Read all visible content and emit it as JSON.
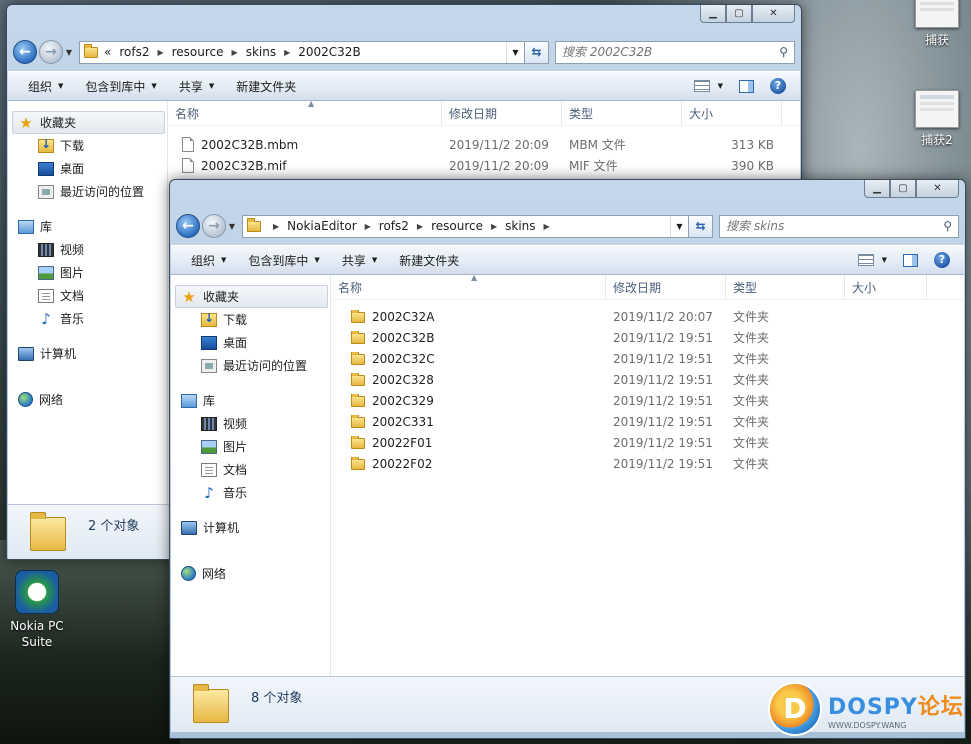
{
  "desktop": {
    "icons": [
      {
        "label": "捕获"
      },
      {
        "label": "捕获2"
      },
      {
        "label": "Nokia PC\nSuite"
      }
    ],
    "watermark": {
      "brand": "DOSPY",
      "brand_cn": "论坛",
      "url": "WWW.DOSPY.WANG"
    }
  },
  "back_window": {
    "breadcrumbs": [
      "«",
      "rofs2",
      "resource",
      "skins",
      "2002C32B"
    ],
    "search_placeholder": "搜索 2002C32B",
    "toolbar": {
      "organize": "组织",
      "include": "包含到库中",
      "share": "共享",
      "new_folder": "新建文件夹"
    },
    "nav": {
      "favorites": "收藏夹",
      "downloads": "下载",
      "desktop": "桌面",
      "recent": "最近访问的位置",
      "libraries": "库",
      "videos": "视频",
      "pictures": "图片",
      "documents": "文档",
      "music": "音乐",
      "computer": "计算机",
      "network": "网络"
    },
    "columns": {
      "name": "名称",
      "modified": "修改日期",
      "type": "类型",
      "size": "大小"
    },
    "files": [
      {
        "name": "2002C32B.mbm",
        "modified": "2019/11/2 20:09",
        "type": "MBM 文件",
        "size": "313 KB"
      },
      {
        "name": "2002C32B.mif",
        "modified": "2019/11/2 20:09",
        "type": "MIF 文件",
        "size": "390 KB"
      }
    ],
    "status": "2 个对象"
  },
  "front_window": {
    "breadcrumbs": [
      "NokiaEditor",
      "rofs2",
      "resource",
      "skins"
    ],
    "search_placeholder": "搜索 skins",
    "toolbar": {
      "organize": "组织",
      "include": "包含到库中",
      "share": "共享",
      "new_folder": "新建文件夹"
    },
    "nav": {
      "favorites": "收藏夹",
      "downloads": "下载",
      "desktop": "桌面",
      "recent": "最近访问的位置",
      "libraries": "库",
      "videos": "视频",
      "pictures": "图片",
      "documents": "文档",
      "music": "音乐",
      "computer": "计算机",
      "network": "网络"
    },
    "columns": {
      "name": "名称",
      "modified": "修改日期",
      "type": "类型",
      "size": "大小"
    },
    "folders": [
      {
        "name": "2002C32A",
        "modified": "2019/11/2 20:07",
        "type": "文件夹"
      },
      {
        "name": "2002C32B",
        "modified": "2019/11/2 19:51",
        "type": "文件夹"
      },
      {
        "name": "2002C32C",
        "modified": "2019/11/2 19:51",
        "type": "文件夹"
      },
      {
        "name": "2002C328",
        "modified": "2019/11/2 19:51",
        "type": "文件夹"
      },
      {
        "name": "2002C329",
        "modified": "2019/11/2 19:51",
        "type": "文件夹"
      },
      {
        "name": "2002C331",
        "modified": "2019/11/2 19:51",
        "type": "文件夹"
      },
      {
        "name": "20022F01",
        "modified": "2019/11/2 19:51",
        "type": "文件夹"
      },
      {
        "name": "20022F02",
        "modified": "2019/11/2 19:51",
        "type": "文件夹"
      }
    ],
    "status": "8 个对象"
  }
}
